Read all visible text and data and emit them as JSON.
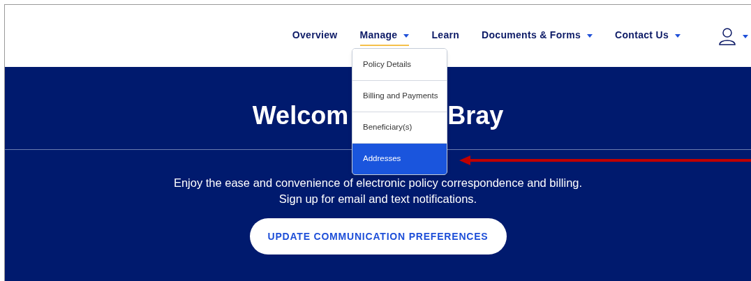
{
  "nav": {
    "items": [
      {
        "label": "Overview",
        "selected": false,
        "dropdown": false
      },
      {
        "label": "Manage",
        "selected": true,
        "dropdown": true
      },
      {
        "label": "Learn",
        "selected": false,
        "dropdown": false
      },
      {
        "label": "Documents & Forms",
        "selected": false,
        "dropdown": true
      },
      {
        "label": "Contact Us",
        "selected": false,
        "dropdown": true
      }
    ]
  },
  "menu": {
    "items": [
      {
        "label": "Policy Details",
        "selected": false
      },
      {
        "label": "Billing and Payments",
        "selected": false
      },
      {
        "label": "Beneficiary(s)",
        "selected": false
      },
      {
        "label": "Addresses",
        "selected": true
      }
    ]
  },
  "hero": {
    "heading_parts": [
      "Welcom",
      "Bray"
    ],
    "lines": [
      "Enjoy the ease and convenience of electronic policy correspondence and billing.",
      "Sign up for email and text notifications."
    ],
    "button": "UPDATE COMMUNICATION PREFERENCES"
  }
}
